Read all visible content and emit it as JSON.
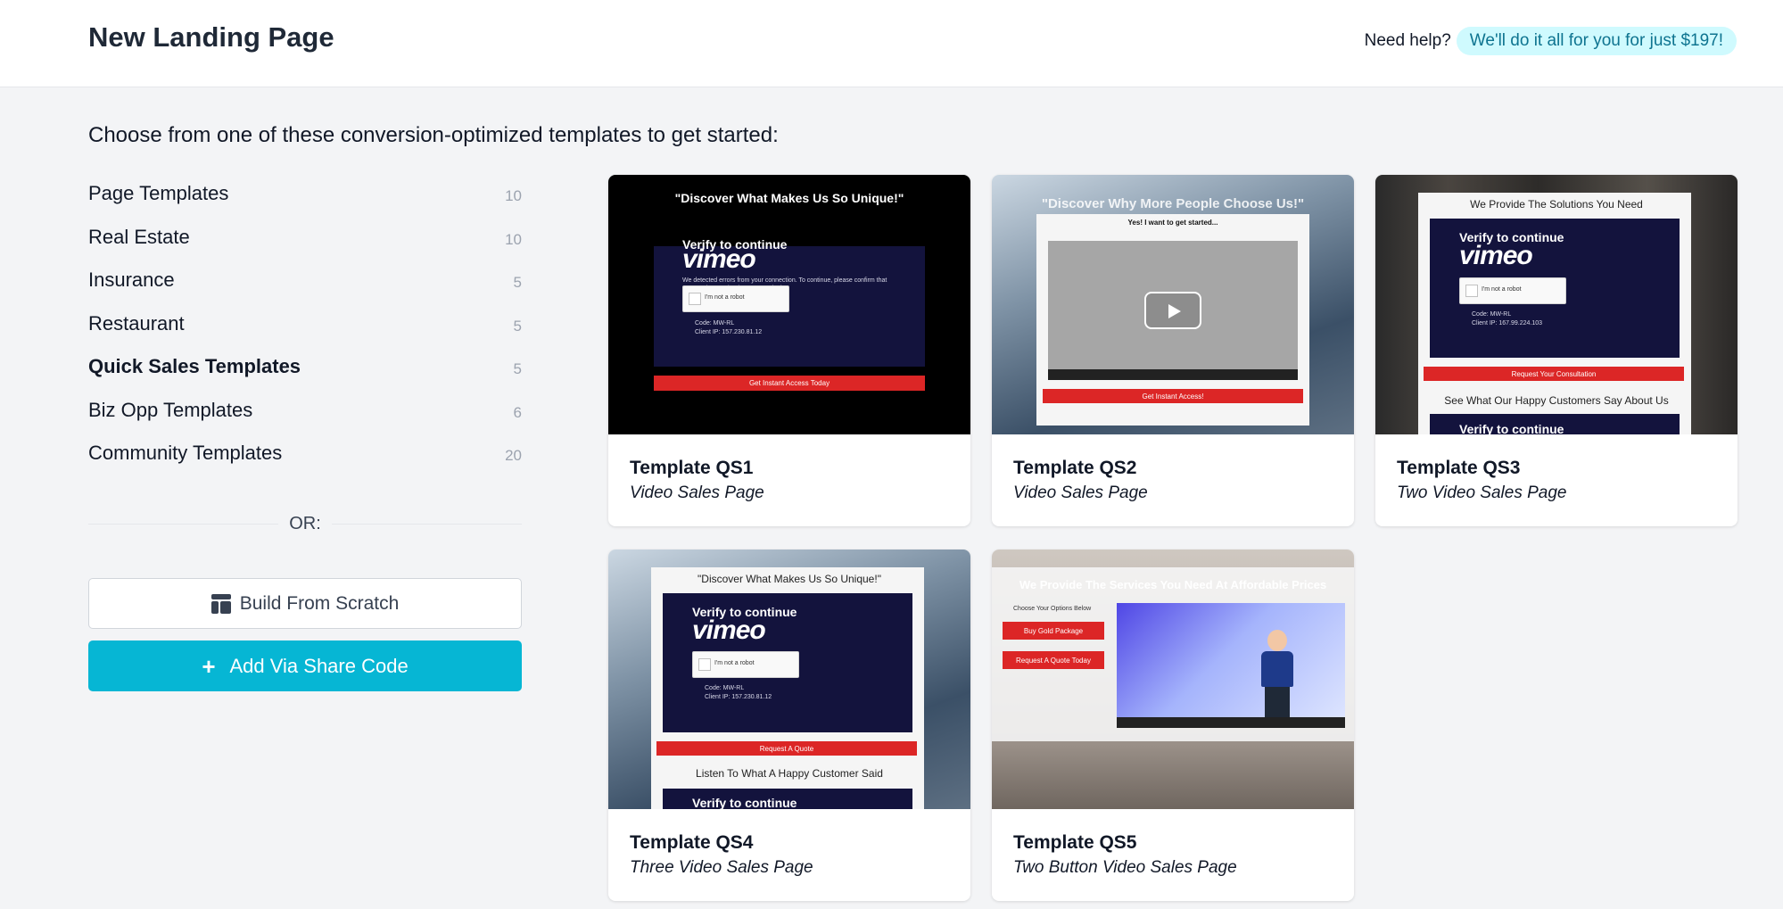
{
  "header": {
    "title": "New Landing Page",
    "help_label": "Need help?",
    "help_offer": "We'll do it all for you for just $197!"
  },
  "subtitle": "Choose from one of these conversion-optimized templates to get started:",
  "categories": [
    {
      "label": "Page Templates",
      "count": "10"
    },
    {
      "label": "Real Estate",
      "count": "10"
    },
    {
      "label": "Insurance",
      "count": "5"
    },
    {
      "label": "Restaurant",
      "count": "5"
    },
    {
      "label": "Quick Sales Templates",
      "count": "5",
      "active": true
    },
    {
      "label": "Biz Opp Templates",
      "count": "6"
    },
    {
      "label": "Community Templates",
      "count": "20"
    }
  ],
  "divider_text": "OR:",
  "buttons": {
    "build_from_scratch": "Build From Scratch",
    "add_via_share_code": "Add Via Share Code"
  },
  "templates": [
    {
      "title": "Template QS1",
      "description": "Video Sales Page",
      "thumb": {
        "headline": "\"Discover What Makes Us So Unique!\"",
        "verify": "Verify to continue",
        "logo": "vimeo",
        "notice": "We detected errors from your connection. To continue, please confirm that you're a human (and not a spambot).",
        "captcha": "I'm not a robot",
        "code": "Code: MW-RL",
        "ip": "Client IP: 157.230.81.12",
        "cta": "Get Instant Access Today"
      }
    },
    {
      "title": "Template QS2",
      "description": "Video Sales Page",
      "thumb": {
        "headline": "\"Discover Why More People Choose Us!\"",
        "subhead": "Yes! I want to get started...",
        "cta": "Get Instant Access!"
      }
    },
    {
      "title": "Template QS3",
      "description": "Two Video Sales Page",
      "thumb": {
        "headline": "We Provide The Solutions You Need",
        "verify": "Verify to continue",
        "logo": "vimeo",
        "captcha": "I'm not a robot",
        "code": "Code: MW-RL",
        "ip": "Client IP: 167.99.224.103",
        "cta": "Request Your Consultation",
        "section": "See What Our Happy Customers Say About Us",
        "verify2": "Verify to continue"
      }
    },
    {
      "title": "Template QS4",
      "description": "Three Video Sales Page",
      "thumb": {
        "headline": "\"Discover What Makes Us So Unique!\"",
        "verify": "Verify to continue",
        "logo": "vimeo",
        "captcha": "I'm not a robot",
        "code": "Code: MW-RL",
        "ip": "Client IP: 157.230.81.12",
        "cta": "Request A Quote",
        "section": "Listen To What A Happy Customer Said",
        "verify2": "Verify to continue"
      }
    },
    {
      "title": "Template QS5",
      "description": "Two Button Video Sales Page",
      "thumb": {
        "headline": "We Provide The Services You Need At Affordable Prices",
        "options": "Choose Your Options Below",
        "btn1": "Buy Gold Package",
        "btn2": "Request A Quote Today"
      }
    }
  ],
  "colors": {
    "accent": "#06b6d4",
    "badge_bg": "#cffafe",
    "badge_text": "#0e7490",
    "cta_red": "#dc2626"
  }
}
